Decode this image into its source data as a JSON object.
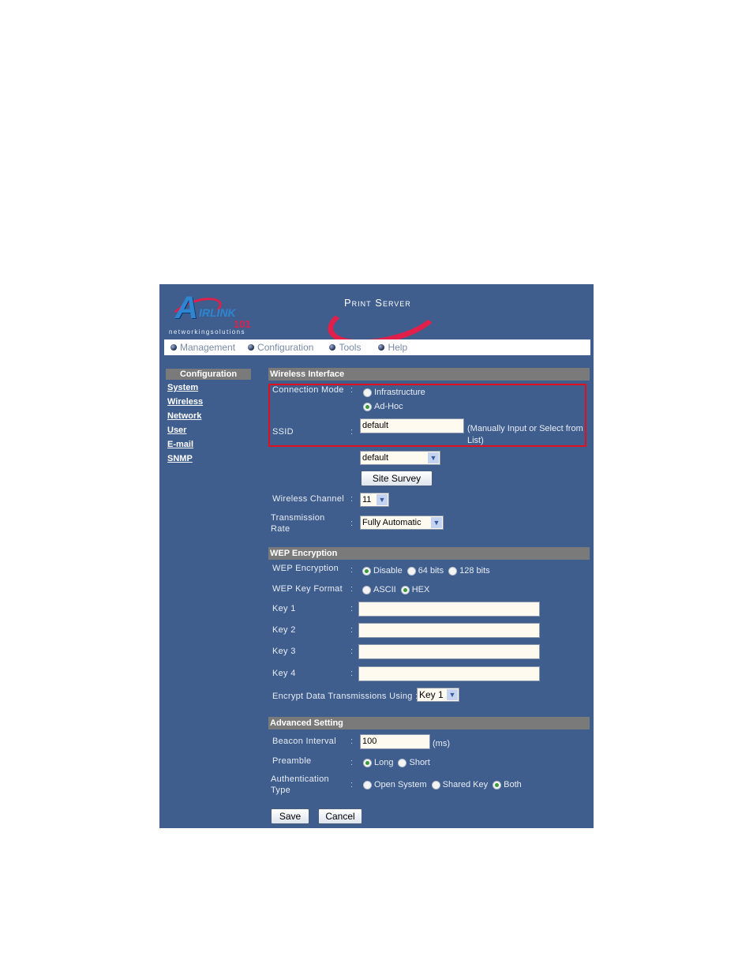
{
  "header": {
    "logo_brand": "AirLink",
    "logo_number": "101",
    "logo_tagline": "networkingsolutions",
    "product_title": "Print Server"
  },
  "nav": {
    "items": [
      {
        "label": "Management"
      },
      {
        "label": "Configuration"
      },
      {
        "label": "Tools"
      },
      {
        "label": "Help"
      }
    ]
  },
  "sidebar": {
    "heading": "Configuration",
    "items": [
      {
        "label": "System"
      },
      {
        "label": "Wireless"
      },
      {
        "label": "Network"
      },
      {
        "label": "User"
      },
      {
        "label": "E-mail"
      },
      {
        "label": "SNMP"
      }
    ]
  },
  "wireless": {
    "heading": "Wireless Interface",
    "connection_mode_label": "Connection Mode",
    "connection_mode_options": [
      "Infrastructure",
      "Ad-Hoc"
    ],
    "connection_mode_selected": "Ad-Hoc",
    "ssid_label": "SSID",
    "ssid_value": "default",
    "ssid_note": "(Manually Input or Select from List)",
    "ssid_list_value": "default",
    "site_survey_label": "Site Survey",
    "channel_label": "Wireless Channel",
    "channel_value": "11",
    "rate_label": "Transmission Rate",
    "rate_value": "Fully Automatic"
  },
  "wep": {
    "heading": "WEP Encryption",
    "encryption_label": "WEP Encryption",
    "encryption_options": [
      "Disable",
      "64 bits",
      "128 bits"
    ],
    "encryption_selected": "Disable",
    "key_format_label": "WEP Key Format",
    "key_format_options": [
      "ASCII",
      "HEX"
    ],
    "key_format_selected": "HEX",
    "keys": [
      {
        "label": "Key 1",
        "value": ""
      },
      {
        "label": "Key 2",
        "value": ""
      },
      {
        "label": "Key 3",
        "value": ""
      },
      {
        "label": "Key 4",
        "value": ""
      }
    ],
    "encrypt_using_label": "Encrypt Data Transmissions Using :",
    "encrypt_using_value": "Key 1"
  },
  "advanced": {
    "heading": "Advanced Setting",
    "beacon_label": "Beacon Interval",
    "beacon_value": "100",
    "beacon_unit": "(ms)",
    "preamble_label": "Preamble",
    "preamble_options": [
      "Long",
      "Short"
    ],
    "preamble_selected": "Long",
    "auth_label": "Authentication Type",
    "auth_options": [
      "Open System",
      "Shared Key",
      "Both"
    ],
    "auth_selected": "Both"
  },
  "actions": {
    "save_label": "Save",
    "cancel_label": "Cancel"
  },
  "colon": ":"
}
